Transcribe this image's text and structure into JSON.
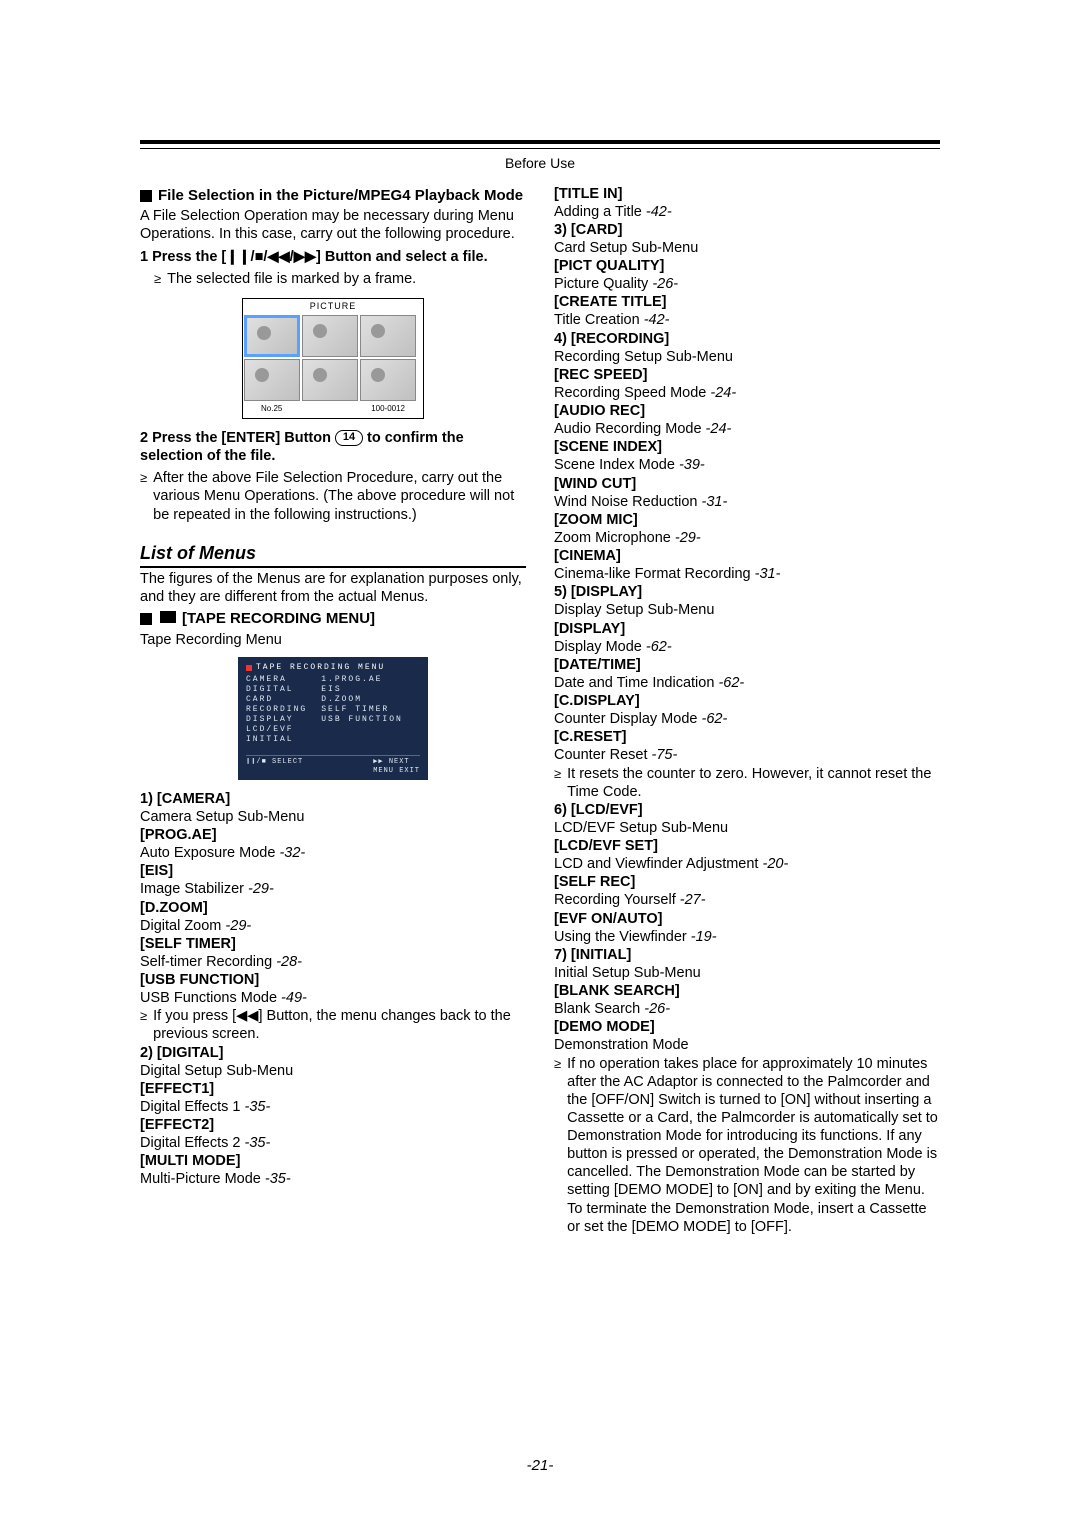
{
  "header": "Before Use",
  "page_number": "-21-",
  "left": {
    "section1_title": "File Selection in the Picture/MPEG4 Playback Mode",
    "section1_intro": "A File Selection Operation may be necessary during Menu Operations. In this case, carry out the following procedure.",
    "step1_prefix": "1 Press the [",
    "step1_glyphs": "❙❙/■/◀◀/▶▶",
    "step1_suffix": "] Button and select a file.",
    "step1_bullet": "The selected file is marked by a frame.",
    "picture_label": "PICTURE",
    "picture_no": "No.25",
    "picture_code": "100-0012",
    "step2_prefix": "2 Press the [ENTER] Button ",
    "step2_circ": "14",
    "step2_suffix": " to confirm the selection of the file.",
    "step2_bullet": "After the above File Selection Procedure, carry out the various Menu Operations. (The above procedure will not be repeated in the following instructions.)",
    "list_of_menus": "List of Menus",
    "menus_intro": "The figures of the Menus are for explanation purposes only, and they are different from the actual Menus.",
    "tape_menu_title": "[TAPE RECORDING MENU]",
    "tape_menu_sub": "Tape Recording Menu",
    "menu_box": {
      "title": "TAPE RECORDING MENU",
      "left_col": "CAMERA\nDIGITAL\nCARD\nRECORDING\nDISPLAY\nLCD/EVF\nINITIAL",
      "right_col": "1.PROG.AE\nEIS\nD.ZOOM\nSELF TIMER\nUSB FUNCTION",
      "foot_left": "❙❙/■ SELECT",
      "foot_right": "▶▶ NEXT\nMENU EXIT"
    },
    "items": [
      {
        "head": "1)   [CAMERA]",
        "text": "Camera Setup Sub-Menu"
      },
      {
        "head": "[PROG.AE]",
        "text": "Auto Exposure Mode ",
        "ref": "-32-"
      },
      {
        "head": "[EIS]",
        "text": "Image Stabilizer ",
        "ref": "-29-"
      },
      {
        "head": "[D.ZOOM]",
        "text": "Digital Zoom ",
        "ref": "-29-"
      },
      {
        "head": "[SELF TIMER]",
        "text": "Self-timer Recording ",
        "ref": "-28-"
      },
      {
        "head": "[USB FUNCTION]",
        "text": "USB Functions Mode ",
        "ref": "-49-"
      }
    ],
    "usb_bullet_prefix": "If you press [",
    "usb_bullet_glyph": "◀◀",
    "usb_bullet_suffix": "] Button, the menu changes back to the previous screen.",
    "items2": [
      {
        "head": "2)   [DIGITAL]",
        "text": "Digital Setup Sub-Menu"
      },
      {
        "head": "[EFFECT1]",
        "text": "Digital Effects 1 ",
        "ref": "-35-"
      },
      {
        "head": "[EFFECT2]",
        "text": "Digital Effects 2 ",
        "ref": "-35-"
      },
      {
        "head": "[MULTI MODE]",
        "text": "Multi-Picture Mode ",
        "ref": "-35-"
      }
    ]
  },
  "right": {
    "items": [
      {
        "head": "[TITLE IN]",
        "text": "Adding a Title ",
        "ref": "-42-"
      },
      {
        "head": "3)   [CARD]",
        "text": "Card Setup Sub-Menu"
      },
      {
        "head": "[PICT QUALITY]",
        "text": "Picture Quality ",
        "ref": "-26-"
      },
      {
        "head": "[CREATE TITLE]",
        "text": "Title Creation ",
        "ref": "-42-"
      },
      {
        "head": "4)   [RECORDING]",
        "text": "Recording Setup Sub-Menu"
      },
      {
        "head": "[REC SPEED]",
        "text": "Recording Speed Mode ",
        "ref": "-24-"
      },
      {
        "head": "[AUDIO REC]",
        "text": "Audio Recording Mode ",
        "ref": "-24-"
      },
      {
        "head": "[SCENE INDEX]",
        "text": "Scene Index Mode ",
        "ref": "-39-"
      },
      {
        "head": "[WIND CUT]",
        "text": "Wind Noise Reduction ",
        "ref": "-31-"
      },
      {
        "head": "[ZOOM MIC]",
        "text": "Zoom Microphone ",
        "ref": "-29-"
      },
      {
        "head": "[CINEMA]",
        "text": "Cinema-like Format Recording ",
        "ref": "-31-"
      },
      {
        "head": "5)   [DISPLAY]",
        "text": "Display Setup Sub-Menu"
      },
      {
        "head": "[DISPLAY]",
        "text": "Display Mode ",
        "ref": "-62-"
      },
      {
        "head": "[DATE/TIME]",
        "text": "Date and Time Indication ",
        "ref": "-62-"
      },
      {
        "head": "[C.DISPLAY]",
        "text": "Counter Display Mode ",
        "ref": "-62-"
      },
      {
        "head": "[C.RESET]",
        "text": "Counter Reset ",
        "ref": "-75-"
      }
    ],
    "creset_bullet": "It resets the counter to zero. However, it cannot reset the Time Code.",
    "items2": [
      {
        "head": "6)   [LCD/EVF]",
        "text": "LCD/EVF Setup Sub-Menu"
      },
      {
        "head": "[LCD/EVF SET]",
        "text": "LCD and Viewfinder Adjustment ",
        "ref": "-20-"
      },
      {
        "head": "[SELF REC]",
        "text": "Recording Yourself ",
        "ref": "-27-"
      },
      {
        "head": "[EVF ON/AUTO]",
        "text": "Using the Viewfinder ",
        "ref": "-19-"
      },
      {
        "head": "7)   [INITIAL]",
        "text": "Initial Setup Sub-Menu"
      },
      {
        "head": "[BLANK SEARCH]",
        "text": "Blank Search ",
        "ref": "-26-"
      },
      {
        "head": "[DEMO MODE]",
        "text": "Demonstration Mode"
      }
    ],
    "demo_bullet": "If no operation takes place for approximately 10 minutes after the AC Adaptor is connected to the Palmcorder and the [OFF/ON] Switch is turned to [ON] without inserting a Cassette or a Card, the Palmcorder is automatically set to Demonstration Mode for introducing its functions. If any button is pressed or operated, the Demonstration Mode is cancelled. The Demonstration Mode can be started by setting [DEMO MODE] to [ON] and by exiting the Menu. To terminate the Demonstration Mode, insert a Cassette or set the [DEMO MODE] to [OFF]."
  }
}
